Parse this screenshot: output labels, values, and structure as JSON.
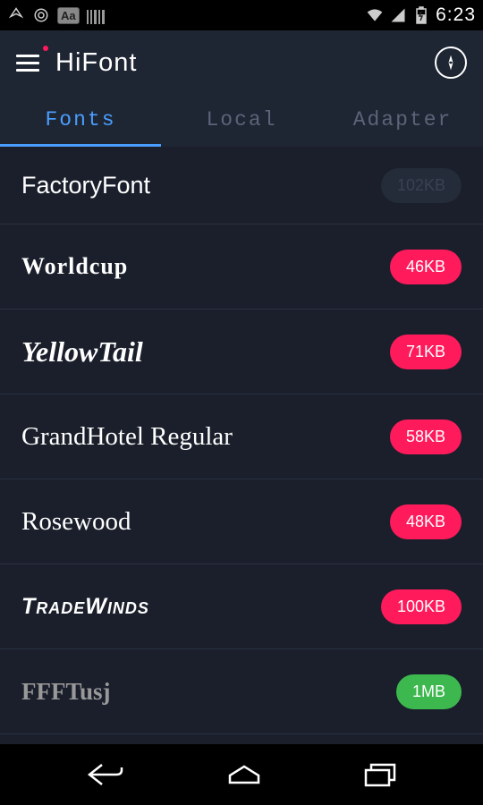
{
  "status": {
    "time": "6:23"
  },
  "app": {
    "title": "HiFont"
  },
  "tabs": [
    {
      "label": "Fonts",
      "active": true
    },
    {
      "label": "Local",
      "active": false
    },
    {
      "label": "Adapter",
      "active": false
    }
  ],
  "fonts": [
    {
      "name": "FactoryFont",
      "size": "102KB",
      "badge_color": "gray",
      "style": "f-factory"
    },
    {
      "name": "Worldcup",
      "size": "46KB",
      "badge_color": "pink",
      "style": "f-worldcup"
    },
    {
      "name": "YellowTail",
      "size": "71KB",
      "badge_color": "pink",
      "style": "f-yellowtail"
    },
    {
      "name": "GrandHotel Regular",
      "size": "58KB",
      "badge_color": "pink",
      "style": "f-grandhotel"
    },
    {
      "name": "Rosewood",
      "size": "48KB",
      "badge_color": "pink",
      "style": "f-rosewood"
    },
    {
      "name": "TradeWinds",
      "size": "100KB",
      "badge_color": "pink",
      "style": "f-tradewinds"
    },
    {
      "name": "FFFTusj",
      "size": "1MB",
      "badge_color": "green",
      "style": "f-ffftusj"
    }
  ]
}
